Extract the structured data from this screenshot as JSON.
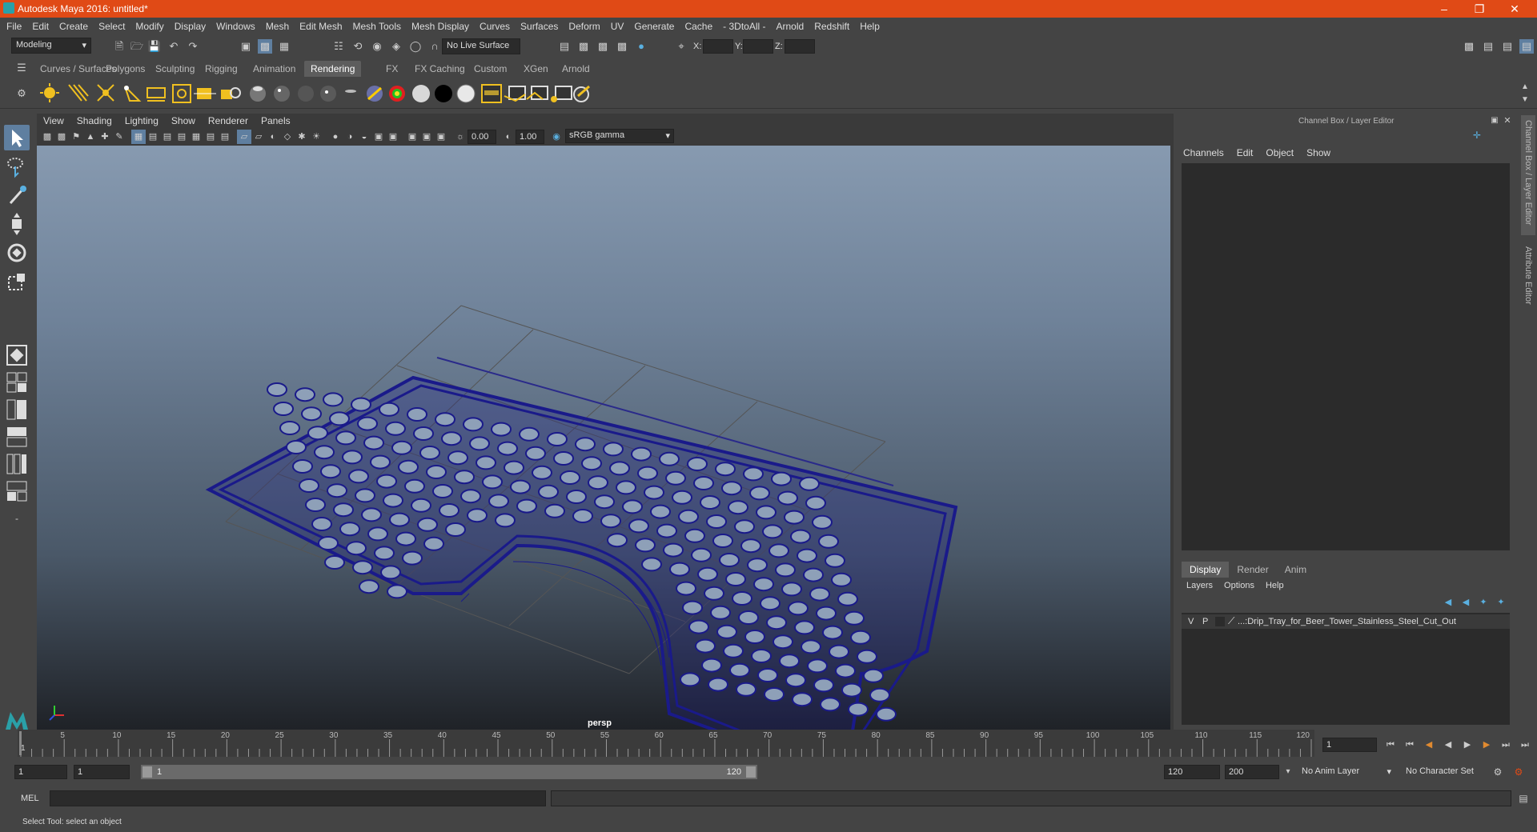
{
  "window": {
    "title": "Autodesk Maya 2016: untitled*"
  },
  "menubar": [
    "File",
    "Edit",
    "Create",
    "Select",
    "Modify",
    "Display",
    "Windows",
    "Mesh",
    "Edit Mesh",
    "Mesh Tools",
    "Mesh Display",
    "Curves",
    "Surfaces",
    "Deform",
    "UV",
    "Generate",
    "Cache",
    "- 3DtoAll -",
    "Arnold",
    "Redshift",
    "Help"
  ],
  "statusline": {
    "mode": "Modeling",
    "live_surface": "No Live Surface",
    "x_label": "X:",
    "y_label": "Y:",
    "z_label": "Z:"
  },
  "shelf_tabs": [
    "Curves / Surfaces",
    "Polygons",
    "Sculpting",
    "Rigging",
    "Animation",
    "Rendering",
    "FX",
    "FX Caching",
    "Custom",
    "XGen",
    "Arnold"
  ],
  "shelf_active": "Rendering",
  "viewport": {
    "menu": [
      "View",
      "Shading",
      "Lighting",
      "Show",
      "Renderer",
      "Panels"
    ],
    "exposure": "0.00",
    "gamma": "1.00",
    "color_space": "sRGB gamma",
    "camera_label": "persp"
  },
  "channelbox": {
    "title": "Channel Box / Layer Editor",
    "menu": [
      "Channels",
      "Edit",
      "Object",
      "Show"
    ],
    "layer_tabs": [
      "Display",
      "Render",
      "Anim"
    ],
    "layer_tab_active": "Display",
    "layer_menu": [
      "Layers",
      "Options",
      "Help"
    ],
    "layer": {
      "v": "V",
      "p": "P",
      "name": "...:Drip_Tray_for_Beer_Tower_Stainless_Steel_Cut_Out"
    }
  },
  "side_tabs": [
    "Channel Box / Layer Editor",
    "Attribute Editor"
  ],
  "timeline": {
    "ticks": [
      "5",
      "10",
      "15",
      "20",
      "25",
      "30",
      "35",
      "40",
      "45",
      "50",
      "55",
      "60",
      "65",
      "70",
      "75",
      "80",
      "85",
      "90",
      "95",
      "100",
      "105",
      "110",
      "115",
      "120"
    ],
    "start_label": "1",
    "current_frame": "1"
  },
  "range": {
    "start": "1",
    "anim_start": "1",
    "slider_start": "1",
    "slider_end": "120",
    "end": "120",
    "anim_end": "200",
    "anim_layer": "No Anim Layer",
    "char_set": "No Character Set"
  },
  "cmdline": {
    "label": "MEL"
  },
  "helpline": {
    "text": "Select Tool: select an object"
  },
  "colors": {
    "title_bar": "#e04a16",
    "mesh_wire": "#1a1a8a",
    "active_tab": "#5d5d5d"
  }
}
